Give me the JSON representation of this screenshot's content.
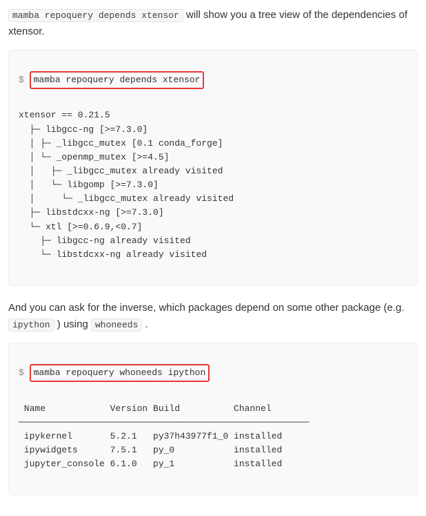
{
  "intro": {
    "part1_code": "mamba repoquery depends xtensor",
    "part1_after": " will show you a tree view of the dependencies of xtensor."
  },
  "block1": {
    "prompt": "$",
    "cmd": "mamba repoquery depends xtensor",
    "body": "xtensor == 0.21.5\n  ├─ libgcc-ng [>=7.3.0]\n  │ ├─ _libgcc_mutex [0.1 conda_forge]\n  │ └─ _openmp_mutex [>=4.5]\n  │   ├─ _libgcc_mutex already visited\n  │   └─ libgomp [>=7.3.0]\n  │     └─ _libgcc_mutex already visited\n  ├─ libstdcxx-ng [>=7.3.0]\n  └─ xtl [>=0.6.9,<0.7]\n    ├─ libgcc-ng already visited\n    └─ libstdcxx-ng already visited"
  },
  "middle": {
    "text_before": "And you can ask for the inverse, which packages depend on some other package (e.g. ",
    "code1": "ipython",
    "text_mid": " ) using ",
    "code2": "whoneeds",
    "text_after": " ."
  },
  "block2": {
    "prompt": "$",
    "cmd": "mamba repoquery whoneeds ipython",
    "body": " Name            Version Build          Channel\n──────────────────────────────────────────────────────\n ipykernel       5.2.1   py37h43977f1_0 installed\n ipywidgets      7.5.1   py_0           installed\n jupyter_console 6.1.0   py_1           installed"
  }
}
